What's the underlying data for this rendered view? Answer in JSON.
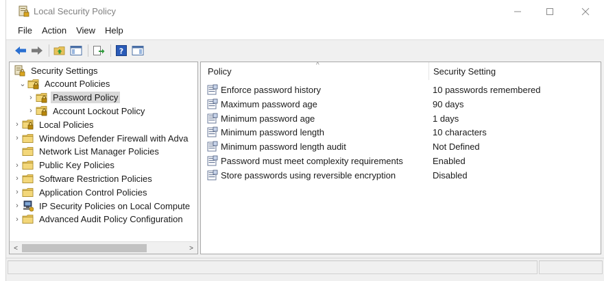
{
  "window": {
    "title": "Local Security Policy",
    "controls": {
      "minimize": "—",
      "maximize": "☐",
      "close": "✕"
    }
  },
  "menu": [
    "File",
    "Action",
    "View",
    "Help"
  ],
  "tree": {
    "items": [
      {
        "label": "Security Settings",
        "chevron": "",
        "icon": "security-settings-icon",
        "selected": false
      },
      {
        "label": "Account Policies",
        "chevron": "⌄",
        "icon": "folder-lock-icon",
        "selected": false
      },
      {
        "label": "Password Policy",
        "chevron": "›",
        "icon": "folder-lock-icon",
        "selected": true
      },
      {
        "label": "Account Lockout Policy",
        "chevron": "›",
        "icon": "folder-lock-icon",
        "selected": false
      },
      {
        "label": "Local Policies",
        "chevron": "›",
        "icon": "folder-lock-icon",
        "selected": false
      },
      {
        "label": "Windows Defender Firewall with Adva",
        "chevron": "›",
        "icon": "folder-icon",
        "selected": false
      },
      {
        "label": "Network List Manager Policies",
        "chevron": "",
        "icon": "folder-icon",
        "selected": false
      },
      {
        "label": "Public Key Policies",
        "chevron": "›",
        "icon": "folder-icon",
        "selected": false
      },
      {
        "label": "Software Restriction Policies",
        "chevron": "›",
        "icon": "folder-icon",
        "selected": false
      },
      {
        "label": "Application Control Policies",
        "chevron": "›",
        "icon": "folder-icon",
        "selected": false
      },
      {
        "label": "IP Security Policies on Local Compute",
        "chevron": "›",
        "icon": "ip-security-icon",
        "selected": false
      },
      {
        "label": "Advanced Audit Policy Configuration",
        "chevron": "›",
        "icon": "folder-icon",
        "selected": false
      }
    ],
    "scroll_left": "<",
    "scroll_right": ">"
  },
  "list": {
    "headers": {
      "policy": "Policy",
      "setting": "Security Setting"
    },
    "sort_caret": "^",
    "rows": [
      {
        "policy": "Enforce password history",
        "setting": "10 passwords remembered"
      },
      {
        "policy": "Maximum password age",
        "setting": "90 days"
      },
      {
        "policy": "Minimum password age",
        "setting": "1 days"
      },
      {
        "policy": "Minimum password length",
        "setting": "10 characters"
      },
      {
        "policy": "Minimum password length audit",
        "setting": "Not Defined"
      },
      {
        "policy": "Password must meet complexity requirements",
        "setting": "Enabled"
      },
      {
        "policy": "Store passwords using reversible encryption",
        "setting": "Disabled"
      }
    ]
  },
  "colors": {
    "selection": "#d9d9d9",
    "folder": "#e8c25a",
    "lock": "#b8860b",
    "toolbar_blue": "#2a6fd1",
    "toolbar_green": "#2e9a3a"
  }
}
